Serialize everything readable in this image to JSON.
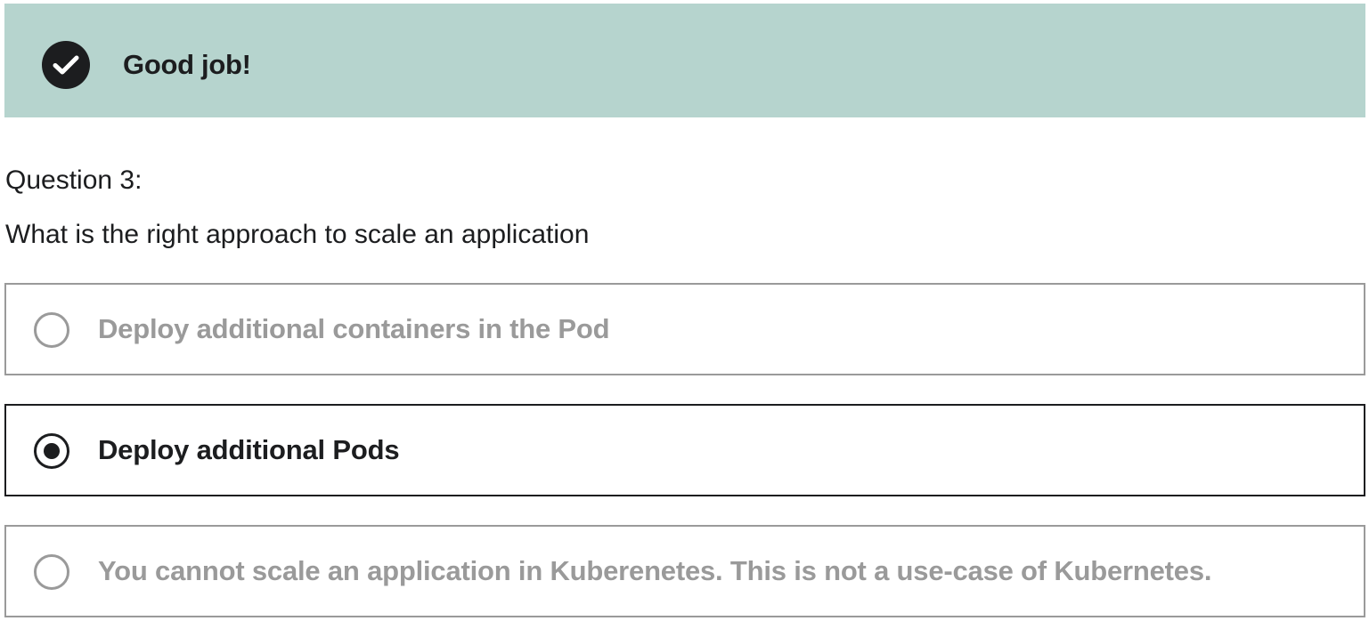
{
  "feedback": {
    "title": "Good job!",
    "icon": "check-circle-icon",
    "background_color": "#b6d4ce"
  },
  "question": {
    "number_label": "Question 3:",
    "text": "What is the right approach to scale an application"
  },
  "options": [
    {
      "label": "Deploy additional containers in the Pod",
      "selected": false
    },
    {
      "label": "Deploy additional Pods",
      "selected": true
    },
    {
      "label": "You cannot scale an application in Kuberenetes. This is not a use-case of Kubernetes.",
      "selected": false
    }
  ],
  "colors": {
    "text_dark": "#1c1d1f",
    "text_muted": "#9a9a9a"
  }
}
